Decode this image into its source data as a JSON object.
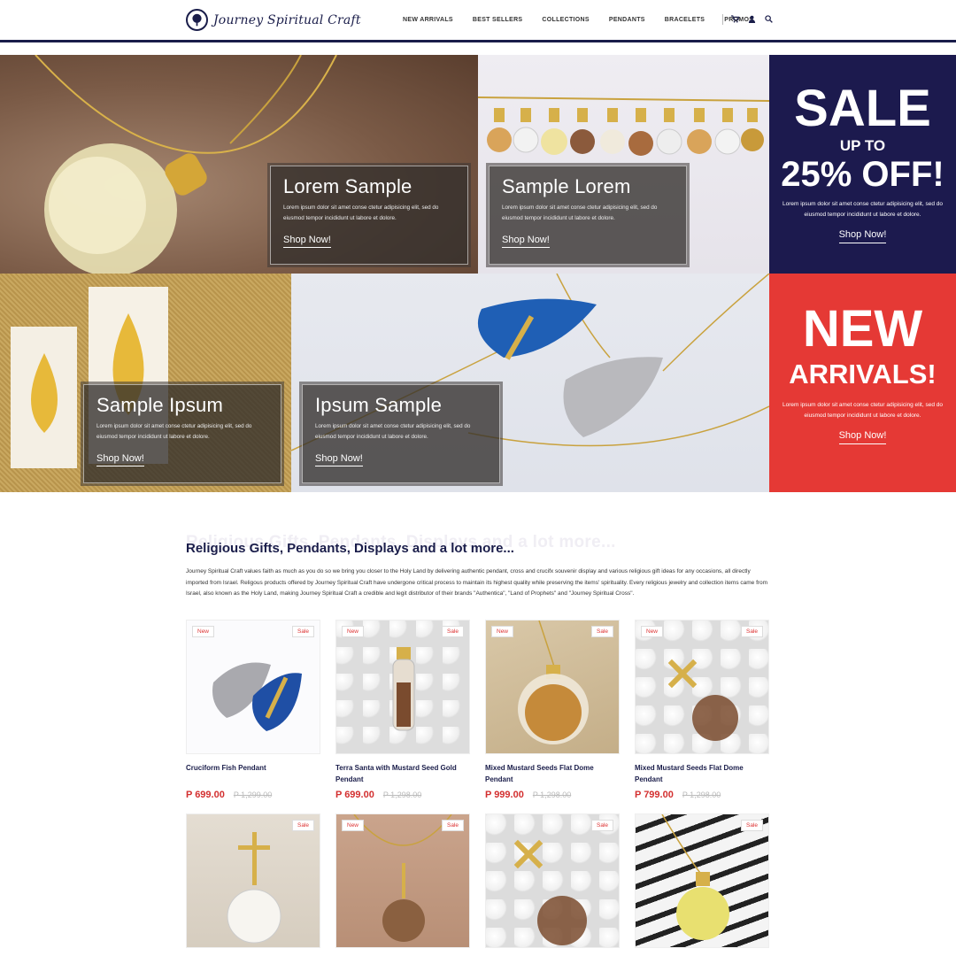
{
  "brand": {
    "name": "Journey Spiritual Craft"
  },
  "nav": {
    "items": [
      "NEW ARRIVALS",
      "BEST SELLERS",
      "COLLECTIONS",
      "PENDANTS",
      "BRACELETS",
      "PROMOS"
    ]
  },
  "colors": {
    "navy": "#1a1d4a",
    "red": "#e53935",
    "price": "#d32f2f"
  },
  "hero": {
    "tiles": [
      {
        "title": "Lorem Sample",
        "text": "Lorem ipsum dolor sit amet conse ctetur adipisicing elit, sed do eiusmod tempor incididunt ut labore et dolore.",
        "cta": "Shop Now!"
      },
      {
        "title": "Sample Lorem",
        "text": "Lorem ipsum dolor sit amet conse ctetur adipisicing elit, sed do eiusmod tempor incididunt ut labore et dolore.",
        "cta": "Shop Now!"
      },
      {
        "title": "Sample Ipsum",
        "text": "Lorem ipsum dolor sit amet conse ctetur adipisicing elit, sed do eiusmod tempor incididunt ut labore et dolore.",
        "cta": "Shop Now!"
      },
      {
        "title": "Ipsum Sample",
        "text": "Lorem ipsum dolor sit amet conse ctetur adipisicing elit, sed do eiusmod tempor incididunt ut labore et dolore.",
        "cta": "Shop Now!"
      }
    ],
    "sale": {
      "line1": "SALE",
      "line2": "UP TO",
      "line3": "25% OFF!",
      "text": "Lorem ipsum dolor sit amet conse ctetur adipisicing elit, sed do eiusmod tempor incididunt ut labore et dolore.",
      "cta": "Shop Now!"
    },
    "new_arrivals": {
      "line1": "NEW",
      "line2": "ARRIVALS!",
      "text": "Lorem ipsum dolor sit amet conse ctetur adipisicing elit, sed do eiusmod tempor incididunt ut labore et dolore.",
      "cta": "Shop Now!"
    }
  },
  "intro": {
    "title": "Religious Gifts, Pendants, Displays and a lot more...",
    "body": "Journey Spiritual Craft values faith as much as you do so we bring you closer to the Holy Land by delivering authentic pendant, cross and crucifx souvenir display and various religious gift ideas for any occasions, all directly imported from Israel. Religous products offered by Journey Spiritual Craft have undergone critical process to maintain its highest quality while preserving the items' spirituality. Every religious jewelry and collection items came from Israel, also known as the Holy Land, making Journey Spiritual Craft a credible and legit distributor of their brands \"Authentica\", \"Land of Prophets\" and \"Journey Spiritual Cross\"."
  },
  "badges": {
    "new": "New",
    "sale": "Sale"
  },
  "products": [
    {
      "name": "Cruciform Fish Pendant",
      "price": "P 699.00",
      "old_price": "P 1,299.00"
    },
    {
      "name": "Terra Santa with Mustard Seed Gold Pendant",
      "price": "P 699.00",
      "old_price": "P 1,298.00"
    },
    {
      "name": "Mixed Mustard Seeds Flat Dome Pendant",
      "price": "P 999.00",
      "old_price": "P 1,298.00"
    },
    {
      "name": "Mixed Mustard Seeds Flat Dome Pendant",
      "price": "P 799.00",
      "old_price": "P 1,298.00"
    }
  ]
}
